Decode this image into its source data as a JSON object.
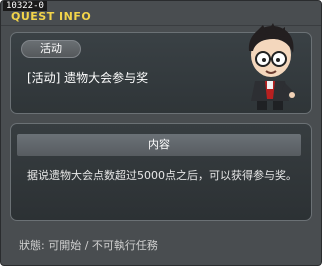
{
  "window": {
    "quest_id": "10322-0",
    "title": "QUEST INFO"
  },
  "quest": {
    "category_tag": "活动",
    "name": "[活动] 遗物大会参与奖"
  },
  "content": {
    "header": "内容",
    "body": "据说遗物大会点数超过5000点之后，可以获得参与奖。"
  },
  "status": {
    "text": "狀態:  可開始  /  不可執行任務"
  },
  "colors": {
    "title": "#f2d44a",
    "window_bg": "#494d50",
    "panel_bg": "#3a4145"
  },
  "icons": [
    "npc-avatar-icon"
  ]
}
